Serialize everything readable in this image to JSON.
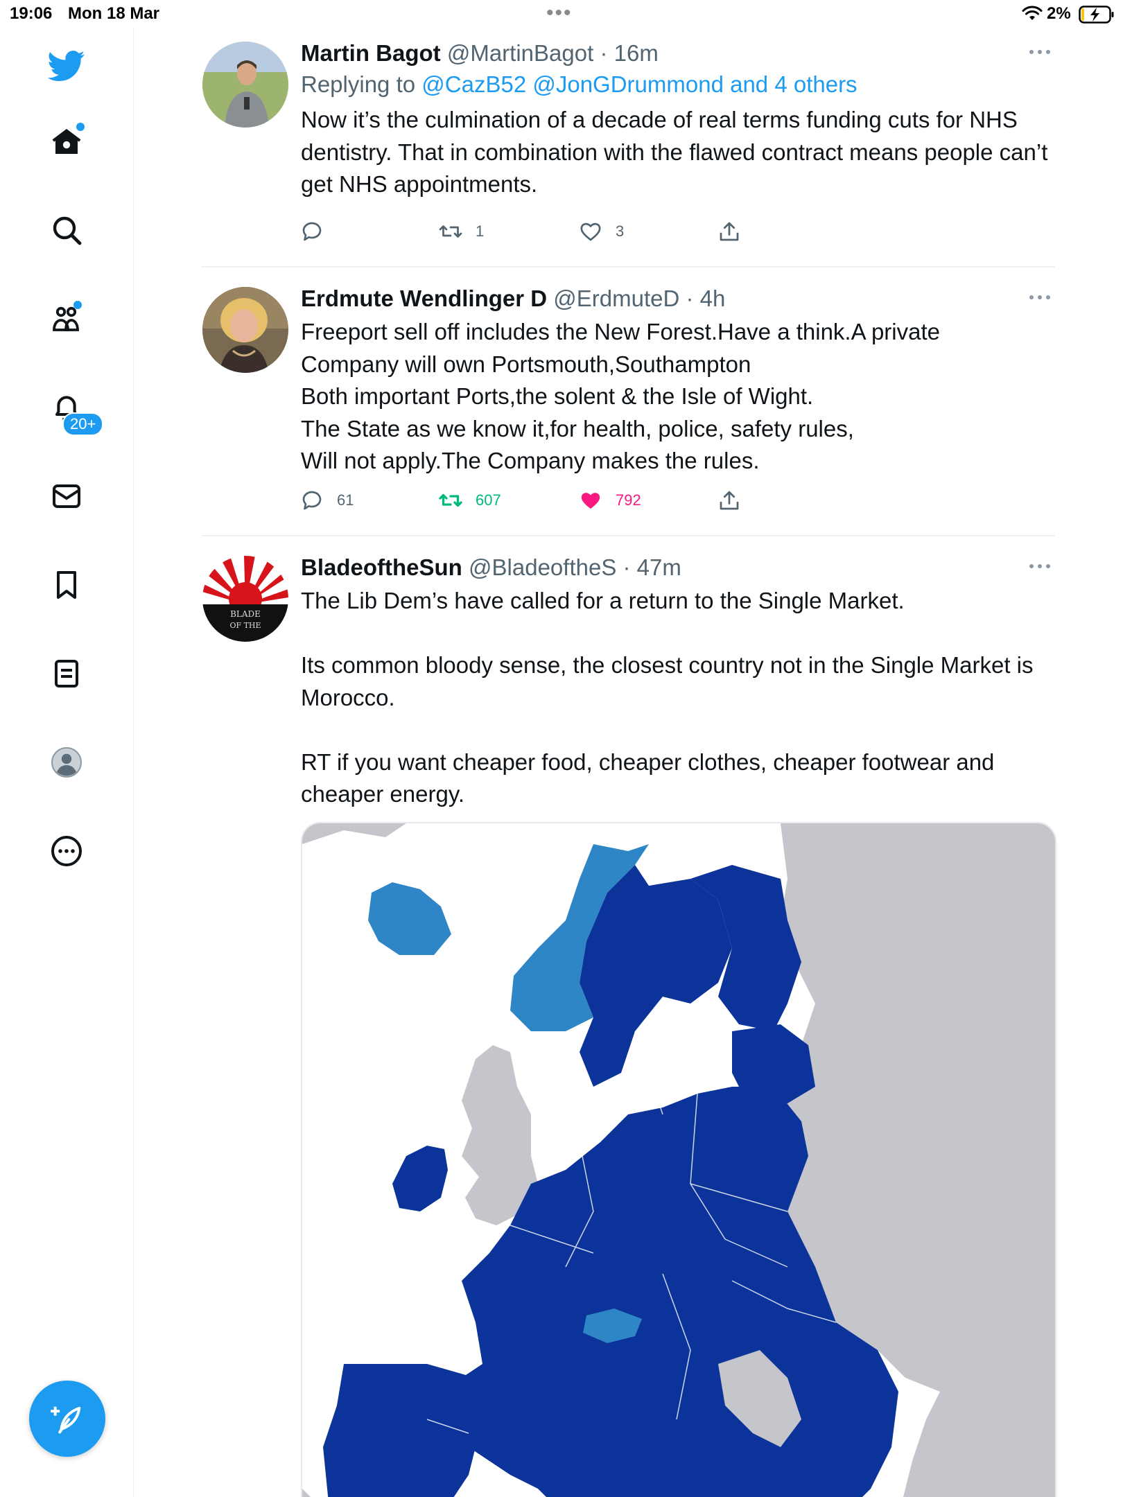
{
  "status_bar": {
    "time": "19:06",
    "date": "Mon 18 Mar",
    "battery": "2%"
  },
  "sidebar": {
    "items": [
      {
        "name": "home",
        "icon": "home-icon",
        "has_dot": true
      },
      {
        "name": "explore",
        "icon": "search-icon"
      },
      {
        "name": "communities",
        "icon": "communities-icon",
        "has_dot": true
      },
      {
        "name": "notifications",
        "icon": "bell-icon",
        "badge": "20+"
      },
      {
        "name": "messages",
        "icon": "mail-icon"
      },
      {
        "name": "bookmarks",
        "icon": "bookmark-icon"
      },
      {
        "name": "lists",
        "icon": "list-icon"
      },
      {
        "name": "profile",
        "icon": "profile-icon"
      },
      {
        "name": "more",
        "icon": "more-circle-icon"
      }
    ],
    "compose_icon": "compose-icon"
  },
  "tweets": [
    {
      "name": "Martin Bagot",
      "handle": "@MartinBagot",
      "time": "16m",
      "reply_prefix": "Replying to ",
      "reply_mentions": "@CazB52 @JonGDrummond and 4 others",
      "text": "Now it’s the culmination of a decade of real terms funding cuts for NHS dentistry. That in combination with the flawed contract means people can’t get NHS appointments.",
      "replies": "",
      "retweets": "1",
      "likes": "3"
    },
    {
      "name": "Erdmute Wendlinger D",
      "handle": "@ErdmuteD",
      "time": "4h",
      "text": "Freeport sell off includes the New Forest.Have a think.A private\nCompany will own Portsmouth,Southampton\nBoth important Ports,the solent & the Isle of Wight.\nThe State as we know it,for health, police, safety rules,\nWill not apply.The Company makes the rules.",
      "replies": "61",
      "retweets": "607",
      "likes": "792"
    },
    {
      "name": "BladeoftheSun",
      "handle": "@BladeoftheS",
      "time": "47m",
      "text": "The Lib Dem’s have called for a return to the Single Market.\n\nIts common bloody sense, the closest country not in the Single Market is Morocco.\n\nRT if you want cheaper food, cheaper clothes, cheaper footwear and cheaper energy.",
      "avatar_text": "BLADE OF THE"
    }
  ],
  "colors": {
    "accent": "#1d9bf0",
    "retweet_active": "#00ba7c",
    "like_active": "#f91880",
    "map_eu": "#0b3399",
    "map_efta": "#2f86c6",
    "map_other": "#c4c6cb"
  }
}
